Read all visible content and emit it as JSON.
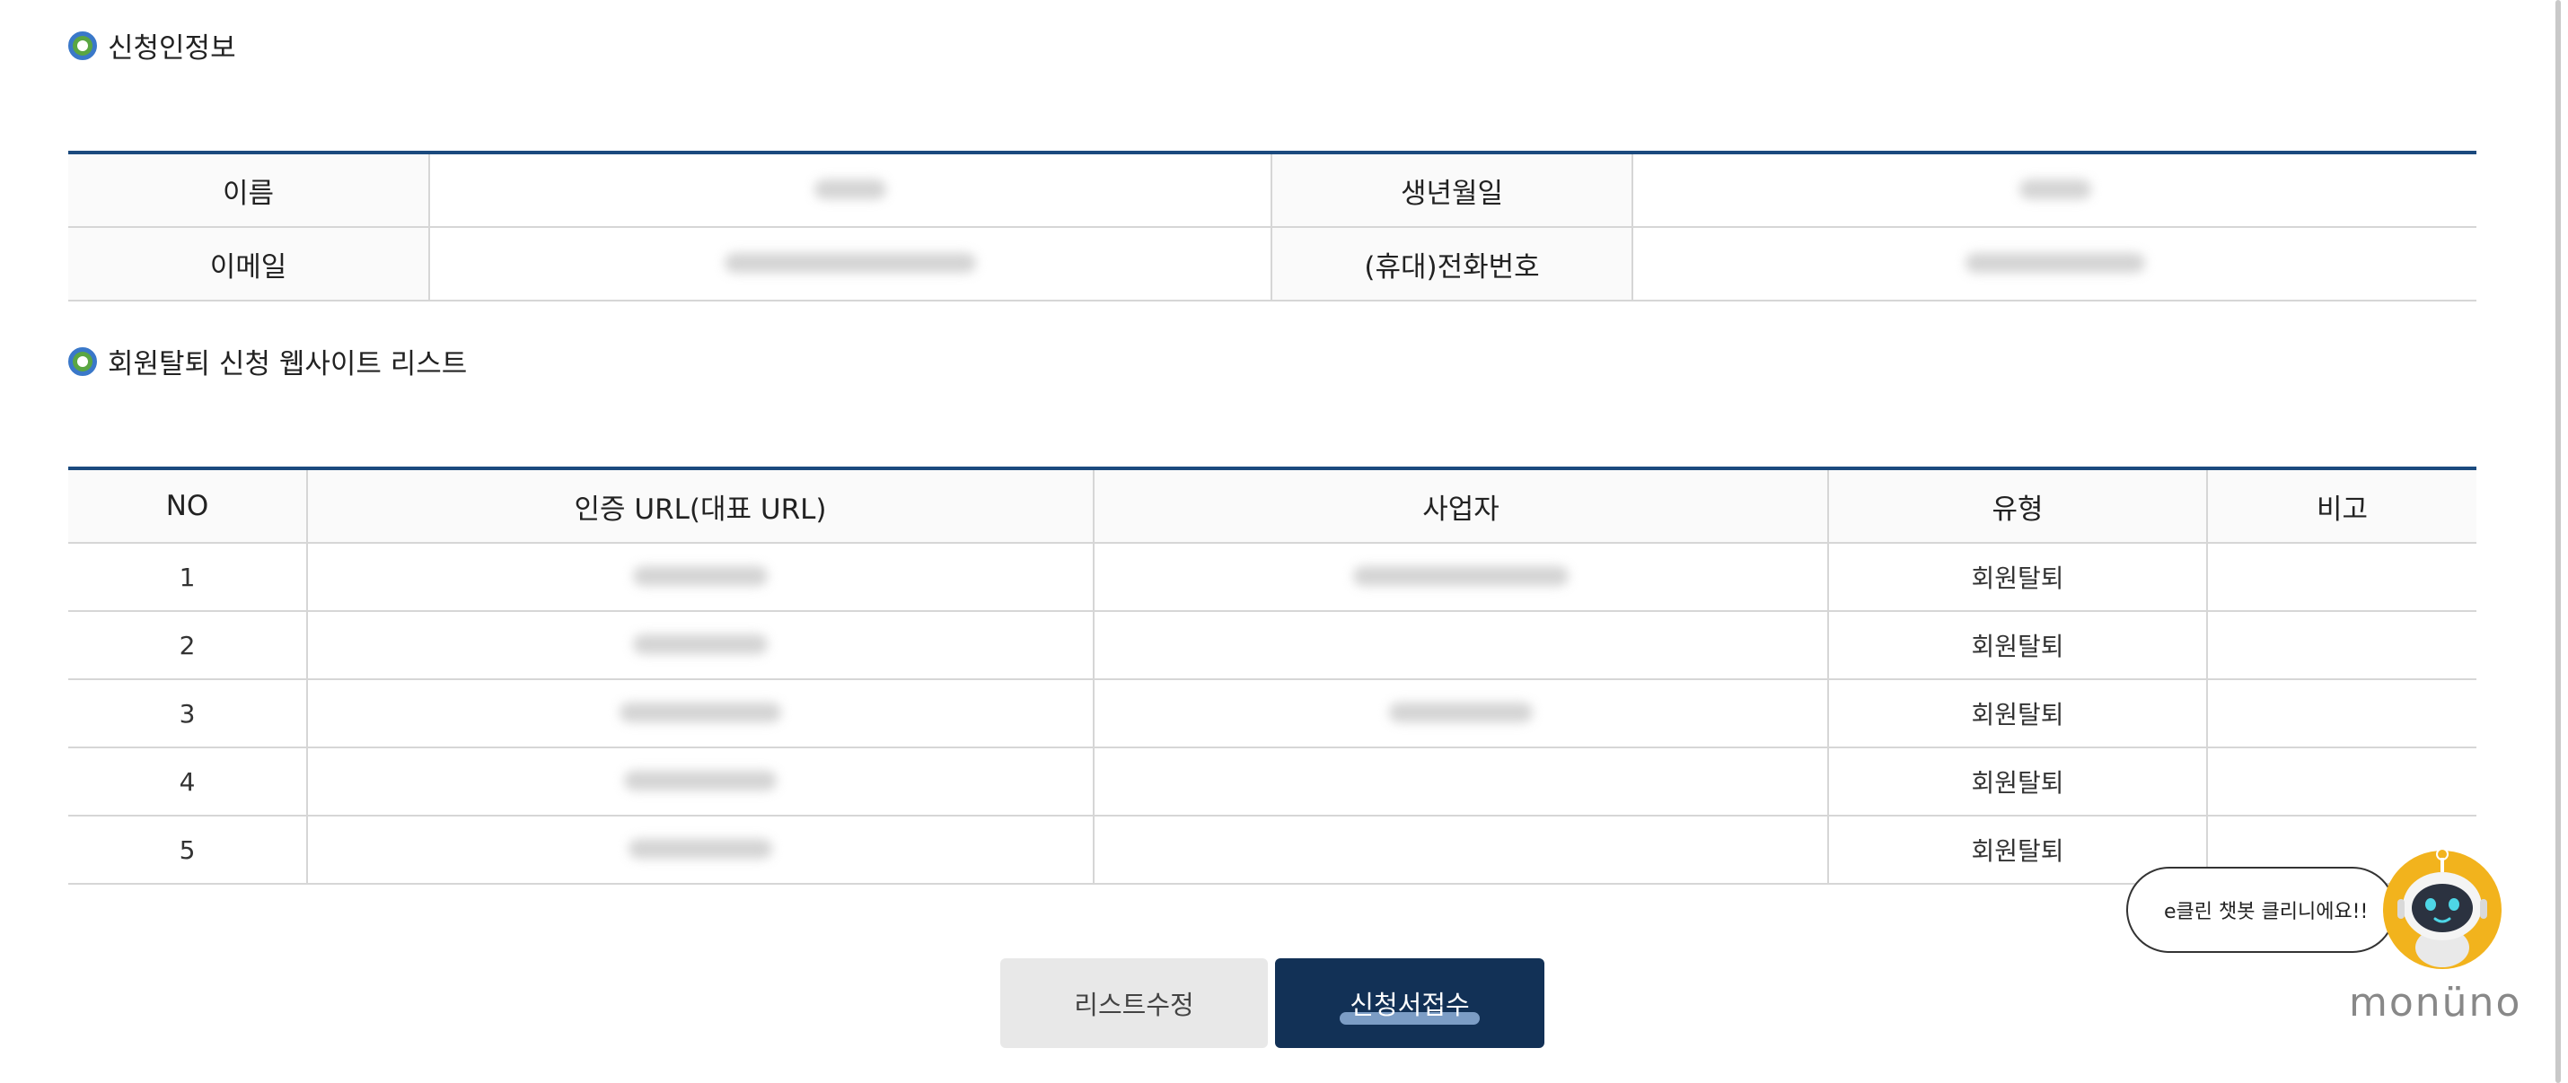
{
  "applicant_section": {
    "title": "신청인정보",
    "fields": [
      {
        "label": "이름"
      },
      {
        "label": "생년월일"
      },
      {
        "label": "이메일"
      },
      {
        "label": "(휴대)전화번호"
      }
    ]
  },
  "website_section": {
    "title": "회원탈퇴 신청 웹사이트 리스트",
    "columns": [
      "NO",
      "인증 URL(대표 URL)",
      "사업자",
      "유형",
      "비고"
    ],
    "rows": [
      {
        "no": "1",
        "type": "회원탈퇴"
      },
      {
        "no": "2",
        "type": "회원탈퇴"
      },
      {
        "no": "3",
        "type": "회원탈퇴"
      },
      {
        "no": "4",
        "type": "회원탈퇴"
      },
      {
        "no": "5",
        "type": "회원탈퇴"
      }
    ]
  },
  "buttons": {
    "edit_list": "리스트수정",
    "submit": "신청서접수"
  },
  "chatbot": {
    "bubble_text": "e클린 챗봇 클리니에요!!",
    "brand": "monüno"
  },
  "colors": {
    "table_border_accent": "#1b4a7e",
    "submit_button": "#123156",
    "edit_button": "#e8e8e8",
    "section_dot_outer": "#3a78c9",
    "section_dot_inner": "#5aa642",
    "robot_ring": "#f2b31d"
  }
}
